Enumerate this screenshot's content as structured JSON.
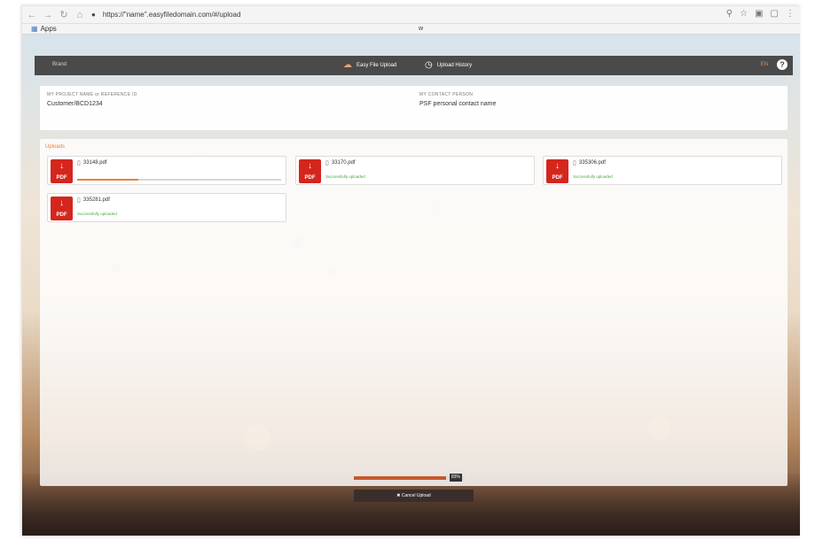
{
  "browser": {
    "url": "https://\"name\".easyfiledomain.com/#/upload",
    "bookmarks": {
      "apps_label": "Apps",
      "center_item": "w"
    }
  },
  "navbar": {
    "brand": "Brand",
    "tab_upload": "Easy File Upload",
    "tab_history": "Upload History",
    "language": "EN"
  },
  "project": {
    "reference_label": "MY PROJECT NAME or REFERENCE ID",
    "reference_value": "Customer/BCD1234",
    "contact_label": "MY CONTACT PERSON",
    "contact_value": "PSF personal contact name"
  },
  "uploads": {
    "heading": "Uploads",
    "files": [
      {
        "name": "33148.pdf",
        "status": "",
        "progress": 0.3
      },
      {
        "name": "33170.pdf",
        "status": "Successfully uploaded",
        "progress": null
      },
      {
        "name": "335306.pdf",
        "status": "Successfully uploaded",
        "progress": null
      },
      {
        "name": "335281.pdf",
        "status": "Successfully uploaded",
        "progress": null
      }
    ],
    "overall_progress": 0.83,
    "overall_label": "83%",
    "cancel_label": "✖ Cancel Upload"
  },
  "colors": {
    "accent": "#e8823d",
    "pdf_red": "#d4261d",
    "navbar": "#4a4a4a",
    "success": "#3fae3f"
  }
}
